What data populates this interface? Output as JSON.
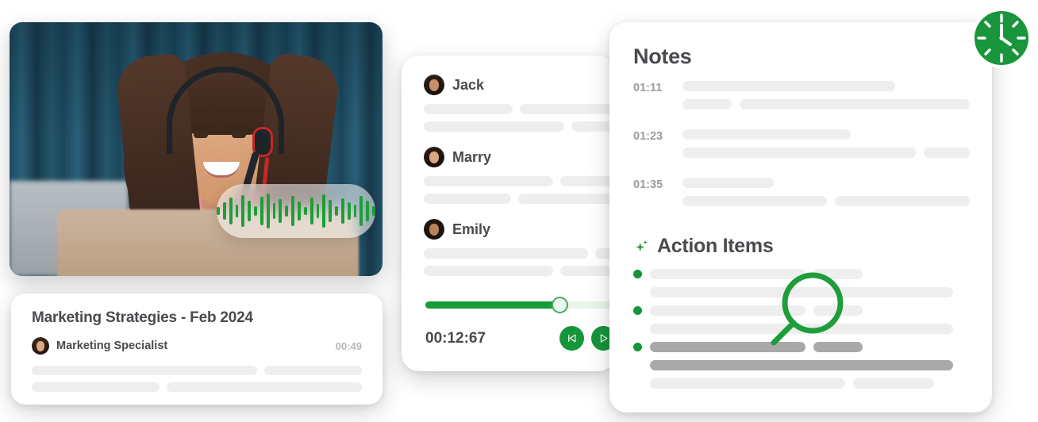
{
  "theme": {
    "accent_green": "#16953a",
    "track_fill": "#159b38",
    "skeleton": "#eeeeee",
    "skeleton_dim": "#a9a9a9",
    "text_dark": "#4a4a4f",
    "text_muted": "#9b9b9f"
  },
  "video_card": {
    "name": "video-preview",
    "waveform": {
      "icon": "audio-waveform",
      "bars": [
        10,
        22,
        34,
        16,
        40,
        26,
        12,
        36,
        44,
        20,
        30,
        14,
        38,
        24,
        10,
        34,
        18,
        42,
        28,
        12,
        32,
        22,
        16,
        38,
        26,
        12
      ]
    }
  },
  "meeting_card": {
    "title": "Marketing Strategies - Feb 2024",
    "participant": "Marketing Specialist",
    "avatar_icon": "avatar",
    "duration": "00:49",
    "skeleton_rows": [
      [
        300,
        130
      ],
      [
        170,
        260
      ]
    ]
  },
  "transcript_card": {
    "speakers": [
      {
        "name": "Jack",
        "avatar_icon": "avatar",
        "rows": [
          [
            120,
            130
          ],
          [
            190,
            60
          ]
        ]
      },
      {
        "name": "Marry",
        "avatar_icon": "avatar",
        "rows": [
          [
            175,
            75
          ],
          [
            118,
            132
          ]
        ]
      },
      {
        "name": "Emily",
        "avatar_icon": "avatar",
        "rows": [
          [
            222,
            28
          ],
          [
            175,
            75
          ]
        ]
      }
    ],
    "player": {
      "time": "00:12:67",
      "progress_percent": 63,
      "rewind_icon": "skip-back-icon",
      "play_icon": "play-icon"
    }
  },
  "notes_card": {
    "title": "Notes",
    "notes": [
      {
        "time": "01:11",
        "rows": [
          [
            268
          ],
          [
            62,
            290
          ]
        ]
      },
      {
        "time": "01:23",
        "rows": [
          [
            212
          ],
          [
            294,
            58
          ]
        ]
      },
      {
        "time": "01:35",
        "rows": [
          [
            115
          ],
          [
            182,
            170
          ]
        ]
      }
    ],
    "action_items": {
      "sparkle_icon": "sparkle-icon",
      "title": "Action Items",
      "items": [
        {
          "bullet": true,
          "rows": [
            [
              196,
              62
            ],
            [
              382
            ]
          ]
        },
        {
          "bullet": true,
          "rows": [
            [
              196,
              62
            ],
            [
              382
            ]
          ]
        },
        {
          "bullet": true,
          "rows": [
            [
              196,
              62
            ],
            [
              382
            ]
          ]
        },
        {
          "bullet": false,
          "rows": [
            [
              246,
              102
            ]
          ]
        }
      ]
    },
    "magnifier_icon": "magnifier-icon"
  },
  "clock_badge": {
    "icon": "clock-icon",
    "label": "clock"
  }
}
